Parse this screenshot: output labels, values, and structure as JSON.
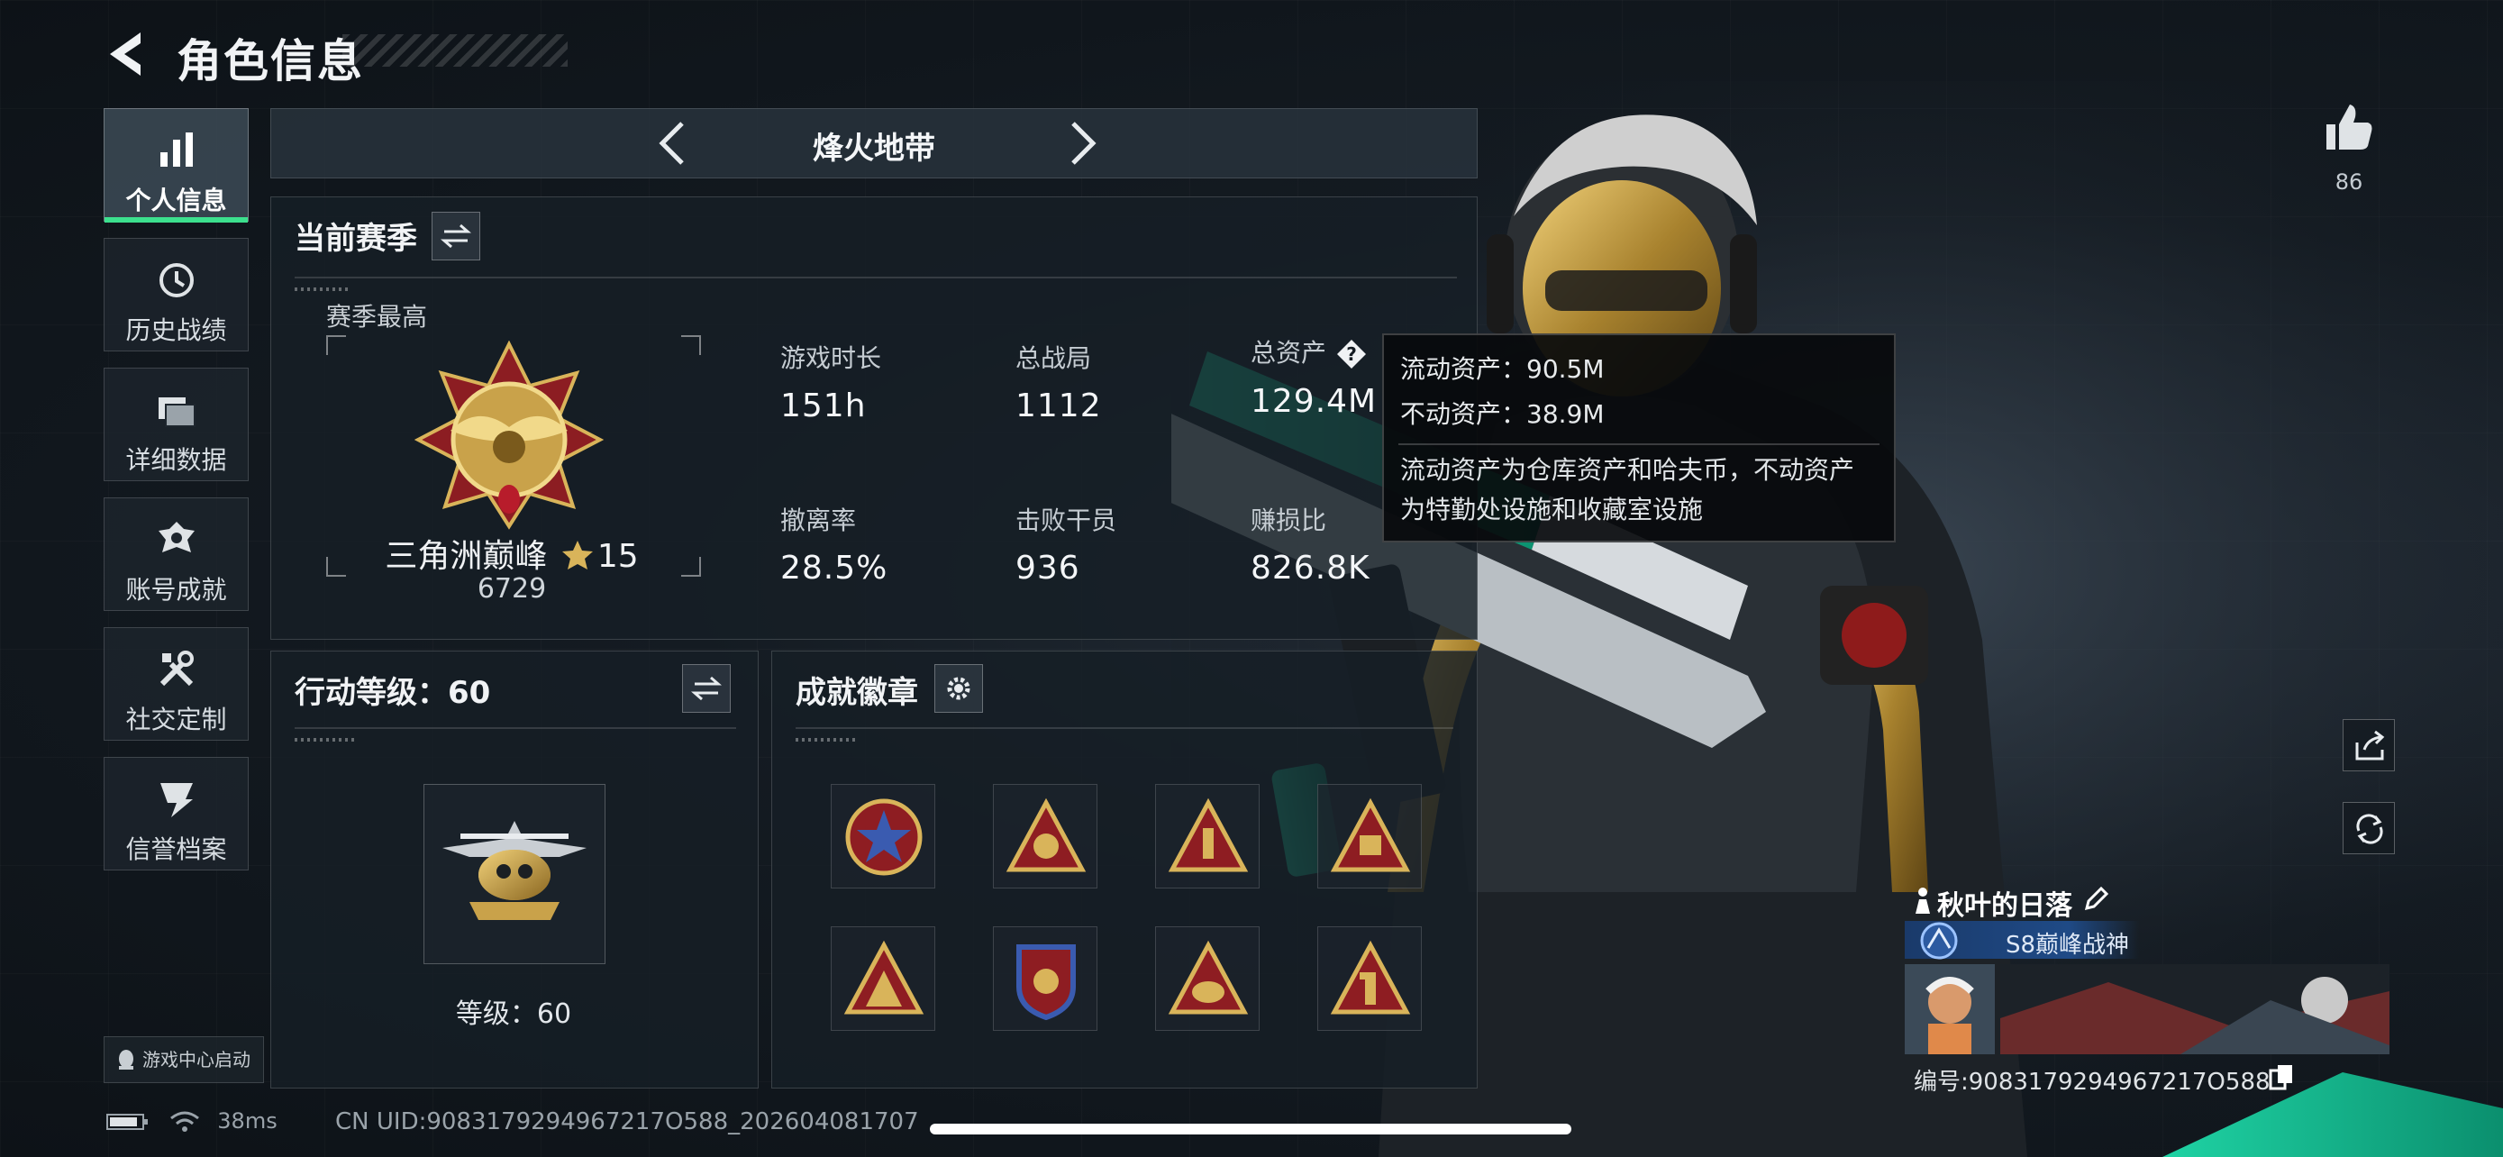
{
  "header": {
    "title": "角色信息"
  },
  "sidebar": {
    "items": [
      {
        "label": "个人信息",
        "icon": "bar-chart-icon",
        "active": true
      },
      {
        "label": "历史战绩",
        "icon": "history-clock-icon"
      },
      {
        "label": "详细数据",
        "icon": "folder-data-icon"
      },
      {
        "label": "账号成就",
        "icon": "achievement-medal-icon"
      },
      {
        "label": "社交定制",
        "icon": "tools-icon"
      },
      {
        "label": "信誉档案",
        "icon": "reputation-shield-icon"
      }
    ],
    "launch_label": "游戏中心启动"
  },
  "mode": {
    "title": "烽火地带"
  },
  "season": {
    "heading": "当前赛季",
    "best_label": "赛季最高",
    "rank_name": "三角洲巅峰",
    "rank_stars": "15",
    "rank_points": "6729",
    "stats": [
      {
        "label": "游戏时长",
        "value": "151h"
      },
      {
        "label": "总战局",
        "value": "1112"
      },
      {
        "label": "总资产",
        "value": "129.4M",
        "has_help": true
      },
      {
        "label": "撤离率",
        "value": "28.5%"
      },
      {
        "label": "击败干员",
        "value": "936"
      },
      {
        "label": "赚损比",
        "value": "826.8K"
      }
    ]
  },
  "tooltip": {
    "liquid": "流动资产：90.5M",
    "fixed": "不动资产：38.9M",
    "desc": "流动资产为仓库资产和哈夫币，不动资产为特勤处设施和收藏室设施"
  },
  "action_level": {
    "heading": "行动等级：60",
    "level_text": "等级：60"
  },
  "badges": {
    "heading": "成就徽章",
    "count": 8
  },
  "likes": {
    "count": "86"
  },
  "player": {
    "name": "秋叶的日落",
    "title": "S8巅峰战神",
    "id_text": "编号:9083179294967217O588"
  },
  "status": {
    "ping": "38ms"
  },
  "uid_line": "CN UID:9083179294967217O588_202604081707",
  "colors": {
    "accent_green": "#3ce08e",
    "gold": "#c9a24a",
    "bg": "#141b22"
  }
}
